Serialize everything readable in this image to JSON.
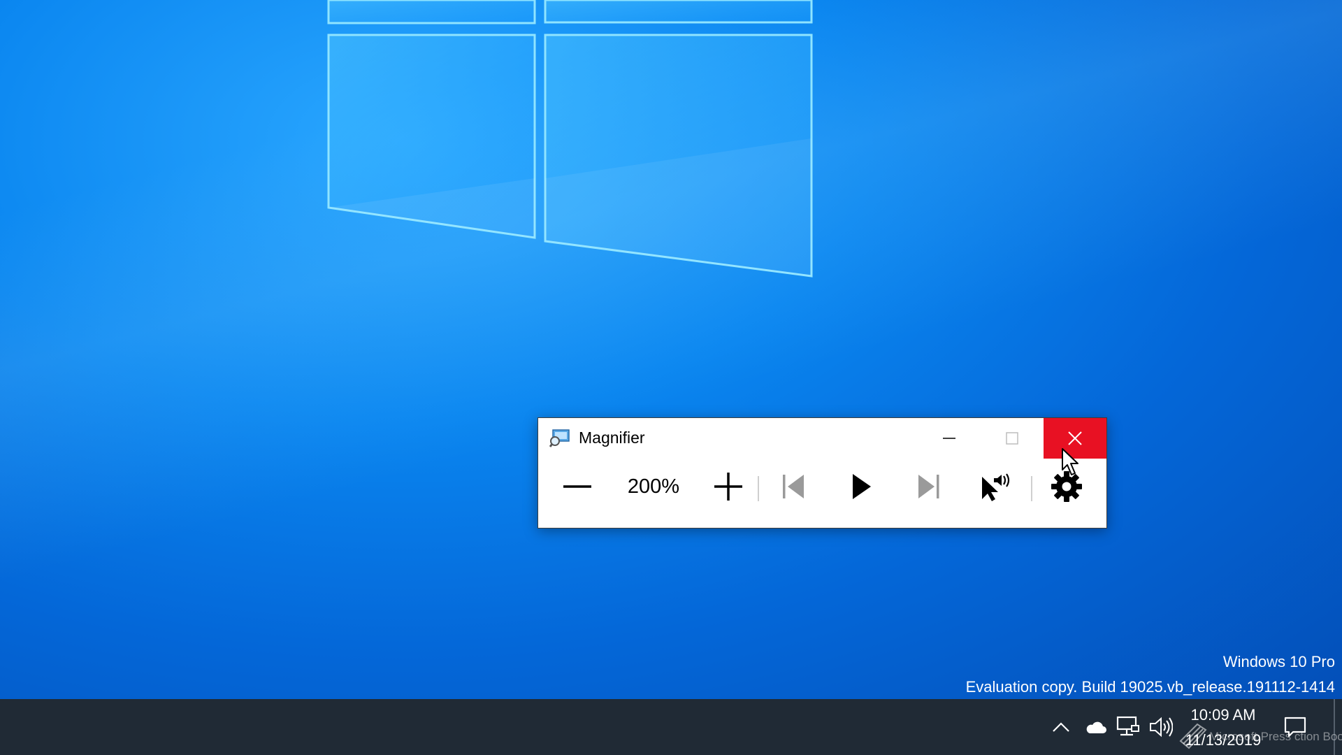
{
  "window": {
    "title": "Magnifier",
    "zoom_level": "200%",
    "icons": {
      "app": "magnifier-app-icon",
      "minimize": "minimize-icon",
      "maximize": "maximize-icon",
      "close": "close-icon",
      "zoom_out": "minus-icon",
      "zoom_in": "plus-icon",
      "previous": "skip-previous-icon",
      "play": "play-icon",
      "next": "skip-next-icon",
      "read_from_here": "read-from-here-icon",
      "settings": "gear-icon"
    },
    "close_hover_color": "#e81123"
  },
  "desktop": {
    "edition": "Windows 10 Pro",
    "build": "Evaluation copy. Build 19025.vb_release.191112-1414"
  },
  "taskbar": {
    "time": "10:09 AM",
    "date": "11/13/2019",
    "publisher_mark": "Microsoft Press ction Book",
    "icons": [
      "chevron-up-icon",
      "onedrive-cloud-icon",
      "network-icon",
      "volume-icon",
      "notifications-icon"
    ],
    "background_color": "#202a35"
  }
}
